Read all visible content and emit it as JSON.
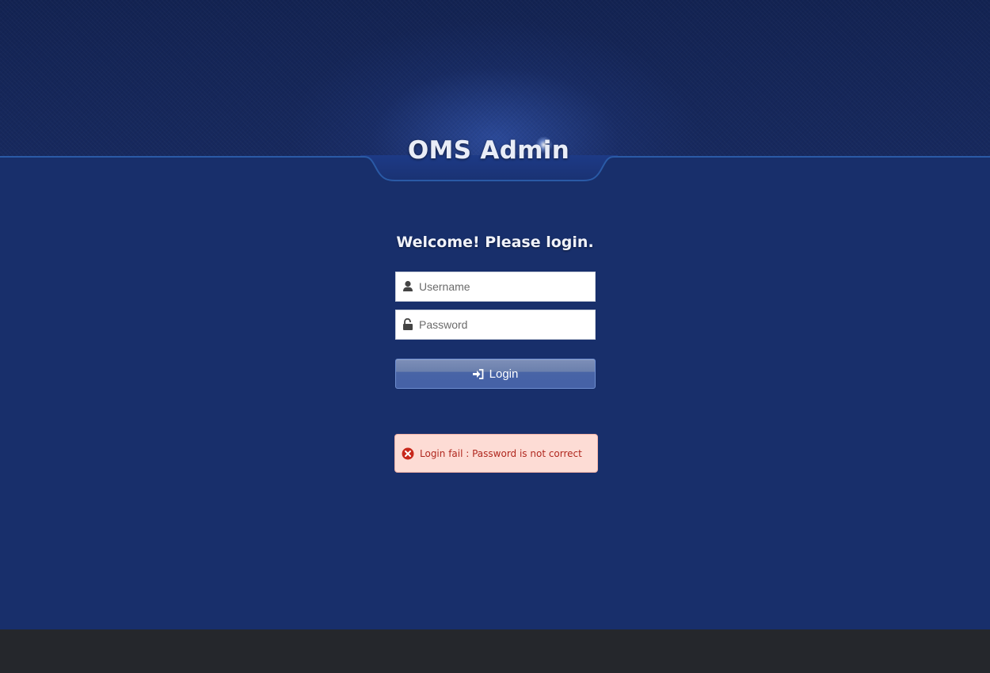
{
  "header": {
    "title": "OMS Admin"
  },
  "login": {
    "welcome": "Welcome! Please login.",
    "username": {
      "placeholder": "Username",
      "value": "",
      "icon": "user-icon"
    },
    "password": {
      "placeholder": "Password",
      "value": "",
      "icon": "unlock-icon"
    },
    "submit": {
      "label": "Login",
      "icon": "sign-in-icon"
    }
  },
  "alert": {
    "icon": "error-circle-icon",
    "message": "Login fail : Password is not correct"
  },
  "colors": {
    "background": "#182f6b",
    "header": "#16275a",
    "footer": "#25272c",
    "alert_bg": "#fddcd5",
    "alert_text": "#b0271e",
    "button": "#4864a6"
  }
}
